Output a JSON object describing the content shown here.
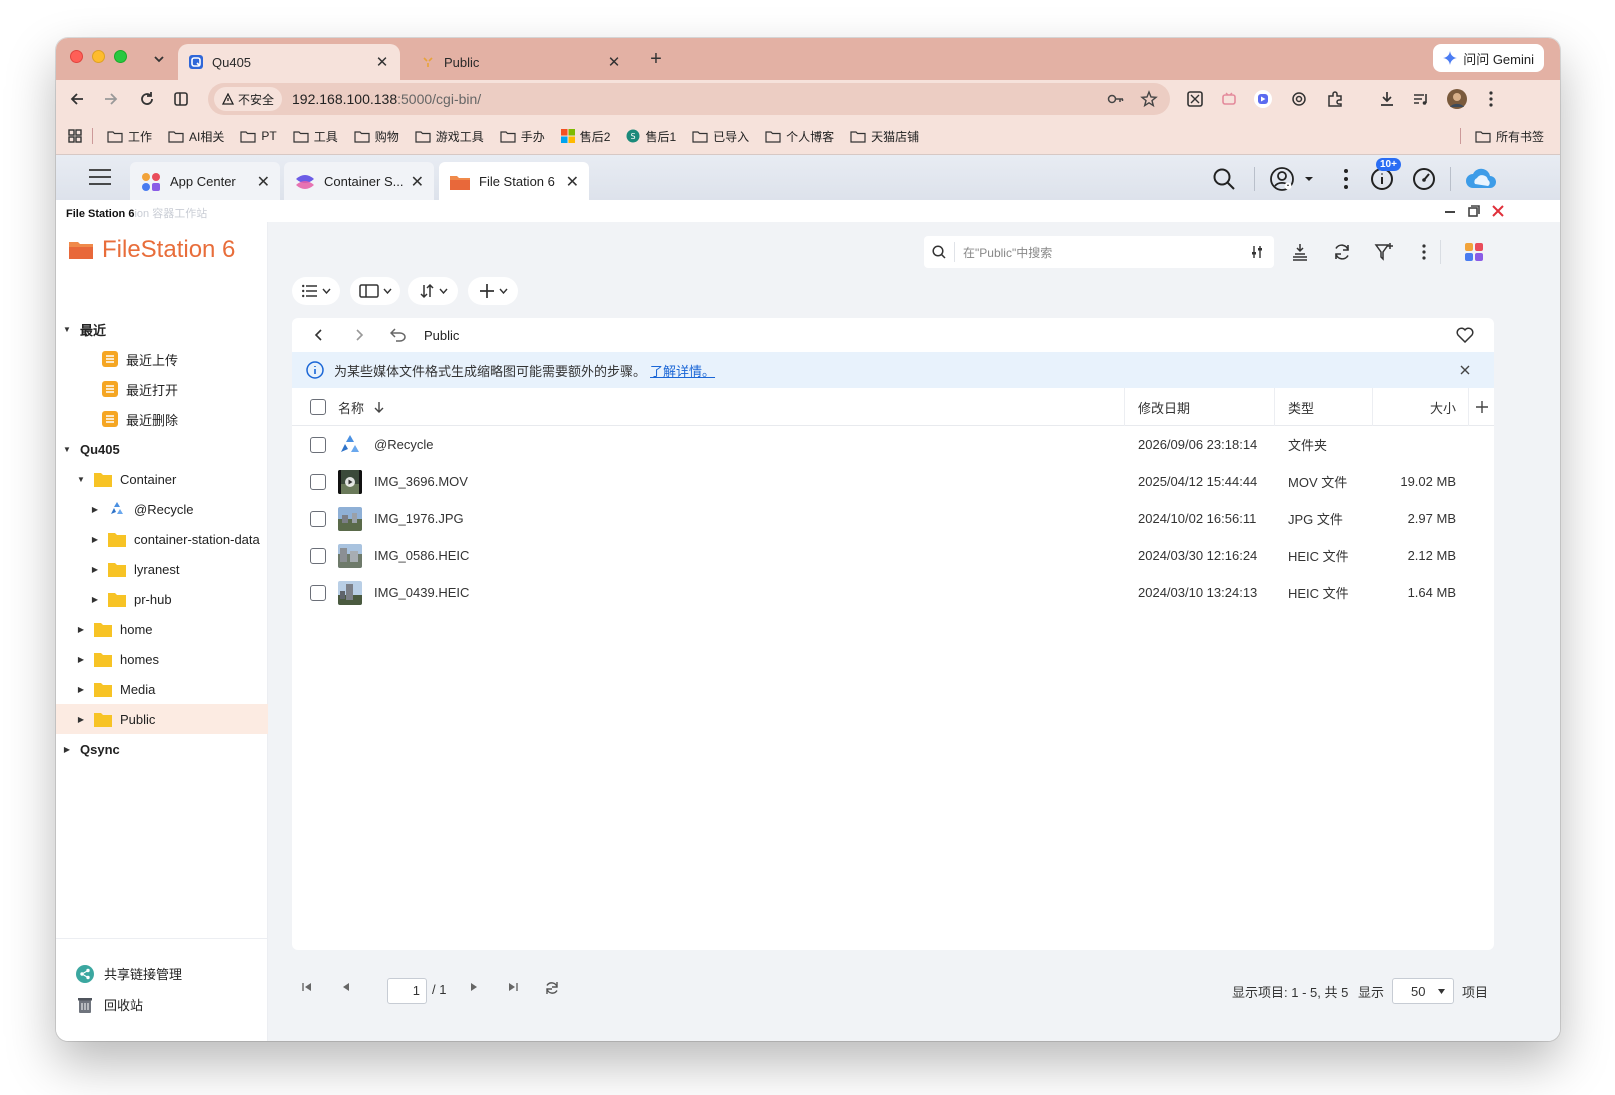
{
  "browser": {
    "tabs": [
      {
        "title": "Qu405",
        "active": true
      },
      {
        "title": "Public",
        "active": false
      }
    ],
    "gemini_label": "问问 Gemini",
    "insecure_label": "不安全",
    "url_host": "192.168.100.138",
    "url_rest": ":5000/cgi-bin/",
    "bookmarks": [
      "工作",
      "AI相关",
      "PT",
      "工具",
      "购物",
      "游戏工具",
      "手办",
      "售后2",
      "售后1",
      "已导入",
      "个人博客",
      "天猫店铺"
    ],
    "all_bookmarks": "所有书签"
  },
  "qts": {
    "tabs": [
      {
        "title": "App Center"
      },
      {
        "title": "Container S..."
      },
      {
        "title": "File Station 6"
      }
    ],
    "notification_badge": "10+"
  },
  "app": {
    "window_title": "File Station 6",
    "window_title_ghost": "ion 容器工作站",
    "brand": "FileStation 6",
    "sidebar": {
      "recent": "最近",
      "recent_items": [
        "最近上传",
        "最近打开",
        "最近删除"
      ],
      "nas": "Qu405",
      "container": "Container",
      "container_children": [
        "@Recycle",
        "container-station-data",
        "lyranest",
        "pr-hub"
      ],
      "folders": [
        "home",
        "homes",
        "Media",
        "Public"
      ],
      "qsync": "Qsync",
      "share_link": "共享链接管理",
      "recycle_bin": "回收站"
    },
    "search_placeholder": "在\"Public\"中搜索",
    "path_current": "Public",
    "notice_text": "为某些媒体文件格式生成缩略图可能需要额外的步骤。",
    "notice_link": "了解详情。",
    "columns": {
      "name": "名称",
      "modified": "修改日期",
      "type": "类型",
      "size": "大小"
    },
    "files": [
      {
        "name": "@Recycle",
        "modified": "2026/09/06 23:18:14",
        "type": "文件夹",
        "size": ""
      },
      {
        "name": "IMG_3696.MOV",
        "modified": "2025/04/12 15:44:44",
        "type": "MOV 文件",
        "size": "19.02 MB"
      },
      {
        "name": "IMG_1976.JPG",
        "modified": "2024/10/02 16:56:11",
        "type": "JPG 文件",
        "size": "2.97 MB"
      },
      {
        "name": "IMG_0586.HEIC",
        "modified": "2024/03/30 12:16:24",
        "type": "HEIC 文件",
        "size": "2.12 MB"
      },
      {
        "name": "IMG_0439.HEIC",
        "modified": "2024/03/10 13:24:13",
        "type": "HEIC 文件",
        "size": "1.64 MB"
      }
    ],
    "pager": {
      "page": "1",
      "total_pages": "/ 1",
      "summary": "显示项目: 1 - 5, 共 5",
      "show_label": "显示",
      "per_page": "50",
      "items_label": "项目"
    },
    "colors": {
      "brand": "#e86d3a",
      "folder": "#f7c325",
      "selected_row": "#fcebe2",
      "notice_bg": "#e8f2fc",
      "link": "#1a66d6"
    }
  }
}
